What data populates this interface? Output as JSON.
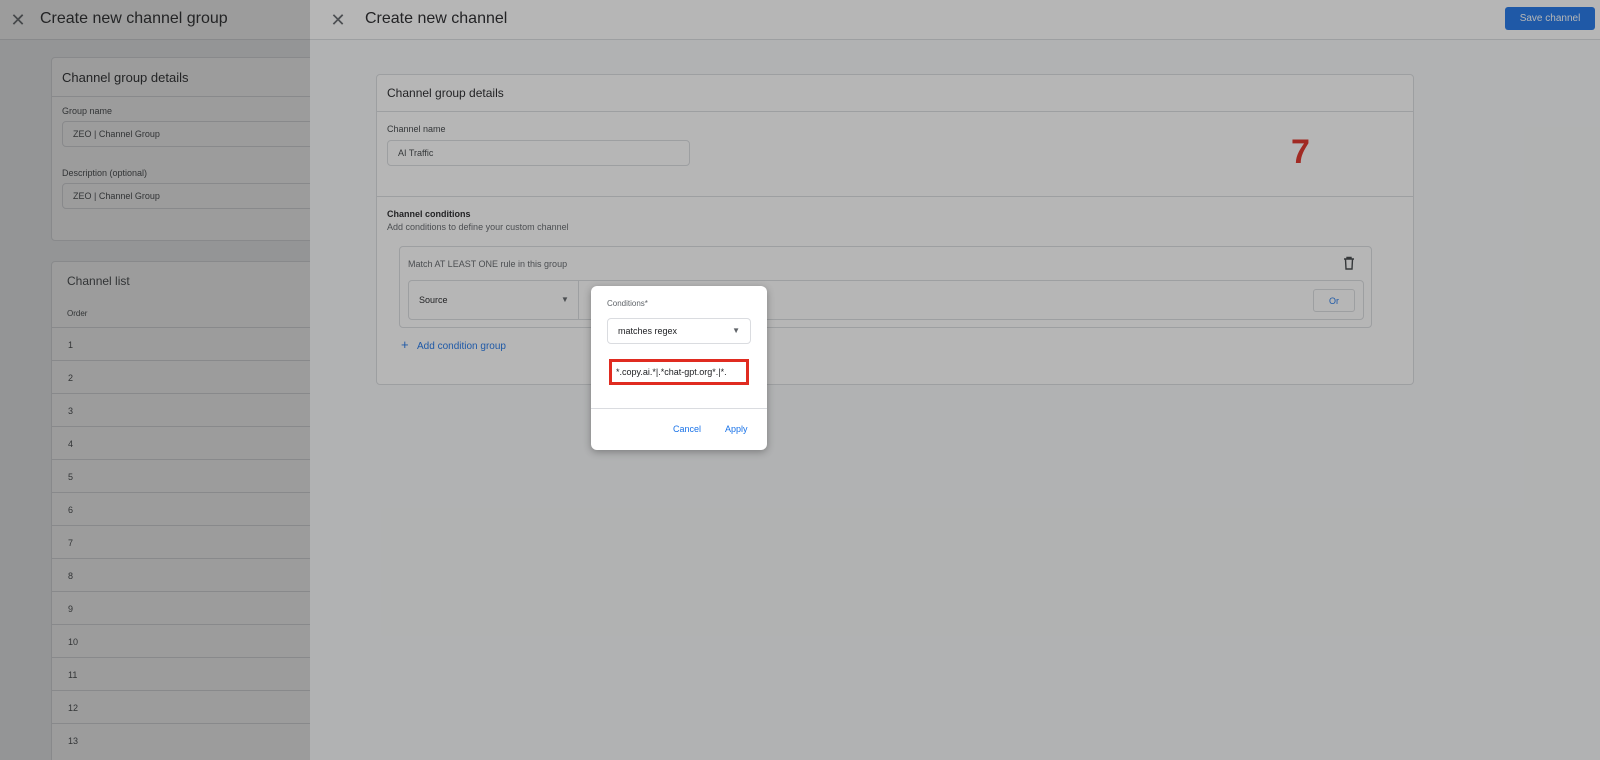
{
  "back_panel": {
    "close_icon": "close-icon",
    "title": "Create new channel group",
    "details": {
      "title": "Channel group details",
      "group_name_label": "Group name",
      "group_name_value": "ZEO | Channel Group",
      "description_label": "Description (optional)",
      "description_value": "ZEO | Channel Group"
    },
    "channel_list": {
      "title": "Channel list",
      "order_header": "Order",
      "rows": [
        "1",
        "2",
        "3",
        "4",
        "5",
        "6",
        "7",
        "8",
        "9",
        "10",
        "11",
        "12",
        "13"
      ]
    }
  },
  "front_panel": {
    "close_icon": "close-icon",
    "title": "Create new channel",
    "save_label": "Save channel",
    "card_title": "Channel group details",
    "channel_name_label": "Channel name",
    "channel_name_value": "AI Traffic",
    "step_number": "7",
    "conditions_heading": "Channel conditions",
    "conditions_sub": "Add conditions to define your custom channel",
    "rule_group_label": "Match AT LEAST ONE rule in this group",
    "dimension_value": "Source",
    "or_label": "Or",
    "add_group_label": "Add condition group"
  },
  "dialog": {
    "label": "Conditions*",
    "operator_value": "matches regex",
    "regex_value": ".*|.*copy.ai.*|.*chat-gpt.org.*",
    "cancel_label": "Cancel",
    "apply_label": "Apply"
  },
  "colors": {
    "accent": "#1a73e8",
    "highlight": "#e02b20"
  }
}
